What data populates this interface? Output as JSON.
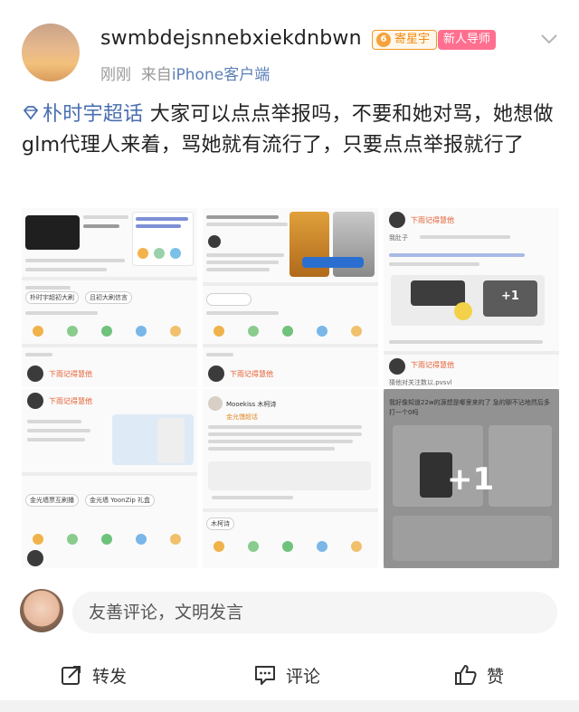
{
  "post": {
    "username": "swmbdejsnnebxiekdnbwn",
    "badge_star": "寄星宇",
    "badge_mentor": "新人导师",
    "time": "刚刚",
    "source_prefix": "来自",
    "source_client": "iPhone客户端",
    "topic": "朴时宇超话",
    "text": " 大家可以点点举报吗，不要和她对骂，她想做glm代理人来着，骂她就有流行了，只要点点举报就行了"
  },
  "images": {
    "c1_chip1": "朴时宇超初大刷",
    "c1_chip2": "且初大刷信言",
    "c3_caption": "我肚子",
    "c3_follow": "猜他对关注数以.pvsvl",
    "c4_chip1": "金光墙票互刷播",
    "c4_chip2": "金光墙 YoonZip 礼盒",
    "c5_user": "Mooekiss 木柯诗",
    "c5_topic": "金允馒超话",
    "c5_chip": "木柯诗",
    "c6_caption": "我好像知道22w的源想是哪里来的了 急的聊不沾地然后多打一个0吗",
    "more_count": "+1",
    "small_more": "+1",
    "name_tag": "下雨记得慧他"
  },
  "comment": {
    "placeholder": "友善评论，文明发言"
  },
  "actions": {
    "repost": "转发",
    "comment": "评论",
    "like": "赞"
  },
  "colors": {
    "topic_link": "#4a6fb0",
    "badge_orange": "#f08a10",
    "badge_pink": "#ff6f8f"
  }
}
